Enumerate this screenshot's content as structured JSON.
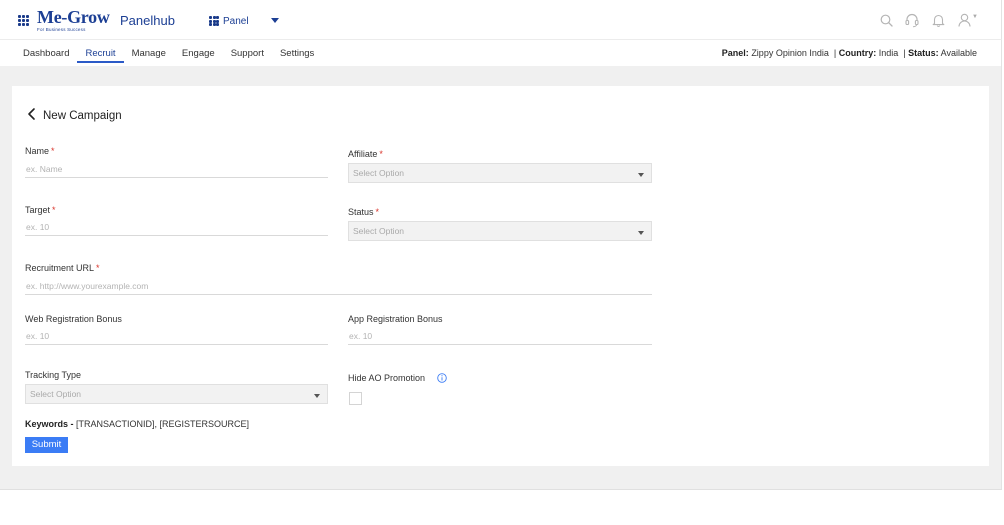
{
  "brand": {
    "logo_text": "Me-Grow",
    "logo_tagline": "For Business Success",
    "app_name": "Panelhub"
  },
  "panel_switch": {
    "label": "Panel"
  },
  "top_icons": [
    "search-icon",
    "headset-icon",
    "bell-icon",
    "user-icon"
  ],
  "nav": {
    "tabs": [
      {
        "label": "Dashboard",
        "active": false
      },
      {
        "label": "Recruit",
        "active": true
      },
      {
        "label": "Manage",
        "active": false
      },
      {
        "label": "Engage",
        "active": false
      },
      {
        "label": "Support",
        "active": false
      },
      {
        "label": "Settings",
        "active": false
      }
    ],
    "info": {
      "panel_label": "Panel:",
      "panel_value": "Zippy Opinion India",
      "country_label": "Country:",
      "country_value": "India",
      "status_label": "Status:",
      "status_value": "Available"
    }
  },
  "form": {
    "title": "New Campaign",
    "name": {
      "label": "Name",
      "placeholder": "ex. Name",
      "required": true
    },
    "affiliate": {
      "label": "Affiliate",
      "value": "Select Option",
      "required": true
    },
    "target": {
      "label": "Target",
      "placeholder": "ex. 10",
      "required": true
    },
    "status": {
      "label": "Status",
      "value": "Select Option",
      "required": true
    },
    "recruitment_url": {
      "label": "Recruitment URL",
      "placeholder": "ex. http://www.yourexample.com",
      "required": true
    },
    "web_bonus": {
      "label": "Web Registration Bonus",
      "placeholder": "ex. 10"
    },
    "app_bonus": {
      "label": "App Registration Bonus",
      "placeholder": "ex. 10"
    },
    "tracking_type": {
      "label": "Tracking Type",
      "value": "Select Option"
    },
    "hide_ao": {
      "label": "Hide AO Promotion",
      "checked": false
    },
    "keywords_label": "Keywords -",
    "keywords_value": "[TRANSACTIONID], [REGISTERSOURCE]",
    "required_mark": "*",
    "submit_label": "Submit"
  },
  "colors": {
    "brand": "#1c3f94",
    "accent": "#3b7cf5",
    "required": "#d9342b",
    "background": "#f0f0f0"
  }
}
